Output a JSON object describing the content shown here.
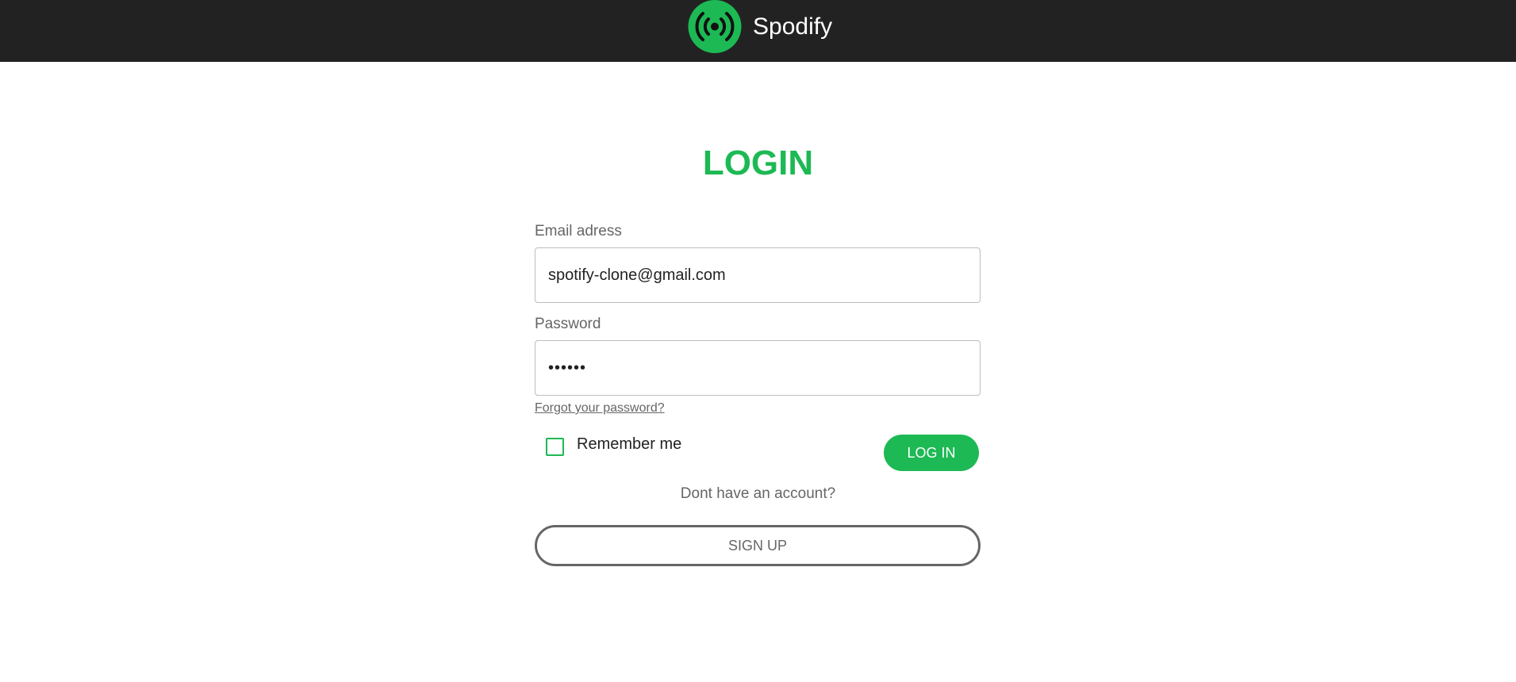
{
  "header": {
    "brand_name": "Spodify",
    "logo_icon": "broadcast-icon",
    "logo_color": "#1db954",
    "background": "#222222"
  },
  "login": {
    "title": "LOGIN",
    "email_label": "Email adress",
    "email_value": "spotify-clone@gmail.com",
    "password_label": "Password",
    "password_value": "••••••",
    "forgot_password": "Forgot your password?",
    "remember_me": "Remember me",
    "remember_checked": false,
    "login_button": "LOG IN",
    "no_account": "Dont have an account?",
    "signup_button": "SIGN UP"
  },
  "colors": {
    "accent": "#1db954",
    "muted_text": "#666666"
  }
}
